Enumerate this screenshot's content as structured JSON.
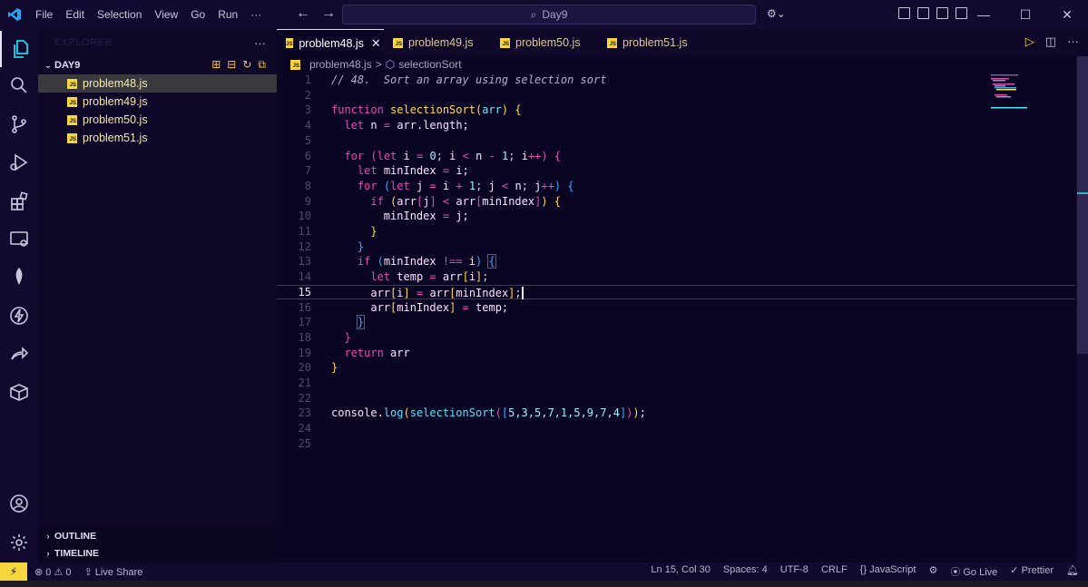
{
  "titlebar": {
    "menu": [
      "File",
      "Edit",
      "Selection",
      "View",
      "Go",
      "Run",
      "···"
    ],
    "search_text": "Day9",
    "window_controls": [
      "—",
      "☐",
      "✕"
    ]
  },
  "sidebar": {
    "header": "EXPLORER",
    "more": "···",
    "folder": "DAY9",
    "files": [
      "problem48.js",
      "problem49.js",
      "problem50.js",
      "problem51.js"
    ],
    "outline": "OUTLINE",
    "timeline": "TIMELINE"
  },
  "tabs": [
    {
      "label": "problem48.js",
      "close": "✕"
    },
    {
      "label": "problem49.js"
    },
    {
      "label": "problem50.js"
    },
    {
      "label": "problem51.js"
    }
  ],
  "breadcrumb": {
    "file": "problem48.js",
    "separator": ">",
    "symbol": "selectionSort"
  },
  "editor": {
    "current_line": 15,
    "line_numbers": [
      "1",
      "2",
      "3",
      "4",
      "5",
      "6",
      "7",
      "8",
      "9",
      "10",
      "11",
      "12",
      "13",
      "14",
      "15",
      "16",
      "17",
      "18",
      "19",
      "20",
      "21",
      "22",
      "23",
      "24",
      "25"
    ],
    "comment": "// 48.  Sort an array using selection sort",
    "function_name": "selectionSort",
    "console_call": "console.log(selectionSort([5,3,5,7,1,5,9,7,4]));"
  },
  "statusbar": {
    "remote_icon": "⚡",
    "problems": "⊗ 0 ⚠ 0",
    "live_share": "Live Share",
    "position": "Ln 15, Col 30",
    "spaces": "Spaces: 4",
    "encoding": "UTF-8",
    "eol": "CRLF",
    "language": "{} JavaScript",
    "go_live": "Go Live",
    "prettier": "✓ Prettier"
  },
  "colors": {
    "background": "#0b0524",
    "keyword": "#e44bb3",
    "function": "#ffdd4d",
    "accent": "#f7d53d"
  }
}
